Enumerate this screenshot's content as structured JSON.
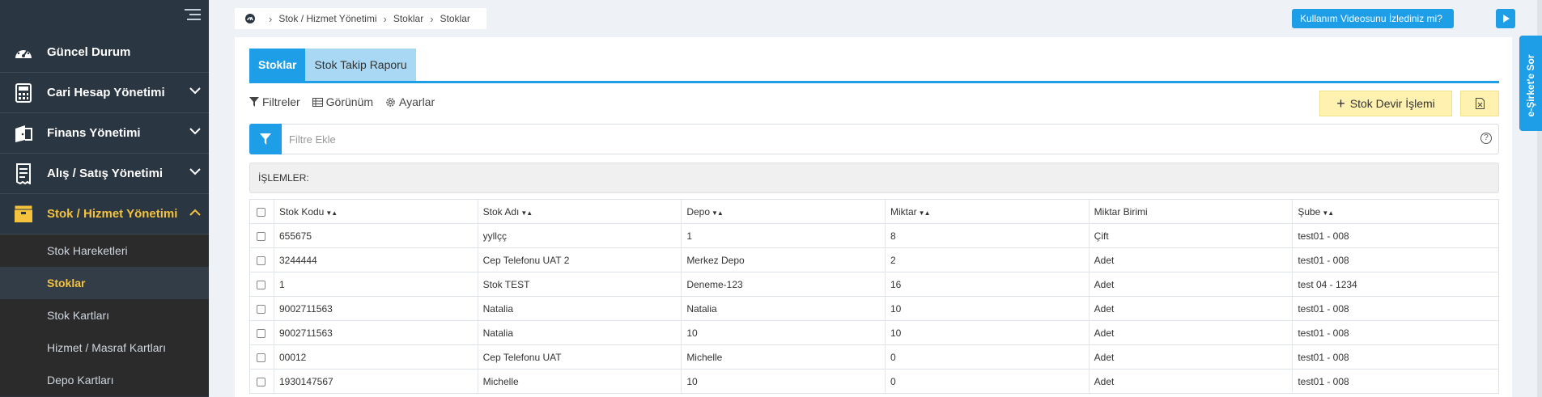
{
  "sidebar": {
    "menu": [
      {
        "label": "Güncel Durum",
        "icon": "dashboard-icon",
        "expandable": false
      },
      {
        "label": "Cari Hesap Yönetimi",
        "icon": "calculator-icon",
        "expandable": true
      },
      {
        "label": "Finans Yönetimi",
        "icon": "wallet-icon",
        "expandable": true
      },
      {
        "label": "Alış / Satış Yönetimi",
        "icon": "receipt-icon",
        "expandable": true
      },
      {
        "label": "Stok / Hizmet Yönetimi",
        "icon": "box-icon",
        "expandable": true,
        "active": true
      }
    ],
    "submenu": [
      {
        "label": "Stok Hareketleri"
      },
      {
        "label": "Stoklar",
        "active": true
      },
      {
        "label": "Stok Kartları"
      },
      {
        "label": "Hizmet / Masraf Kartları"
      },
      {
        "label": "Depo Kartları"
      }
    ]
  },
  "breadcrumb": {
    "items": [
      "Stok / Hizmet Yönetimi",
      "Stoklar",
      "Stoklar"
    ]
  },
  "video_prompt": "Kullanım Videosunu İzlediniz mi?",
  "side_tab": "e-Şirket'e Sor",
  "tabs": [
    {
      "label": "Stoklar",
      "active": true
    },
    {
      "label": "Stok Takip Raporu",
      "active": false
    }
  ],
  "toolbar": {
    "filters": "Filtreler",
    "view": "Görünüm",
    "settings": "Ayarlar",
    "stok_devir": "Stok Devir İşlemi"
  },
  "filter": {
    "placeholder": "Filtre Ekle"
  },
  "section_title": "İŞLEMLER:",
  "table": {
    "columns": [
      "Stok Kodu",
      "Stok Adı",
      "Depo",
      "Miktar",
      "Miktar Birimi",
      "Şube"
    ],
    "rows": [
      [
        "655675",
        "yyllçç",
        "1",
        "8",
        "Çift",
        "test01 - 008"
      ],
      [
        "3244444",
        "Cep Telefonu UAT 2",
        "Merkez Depo",
        "2",
        "Adet",
        "test01 - 008"
      ],
      [
        "1",
        "Stok TEST",
        "Deneme-123",
        "16",
        "Adet",
        "test 04 - 1234"
      ],
      [
        "9002711563",
        "Natalia",
        "Natalia",
        "10",
        "Adet",
        "test01 - 008"
      ],
      [
        "9002711563",
        "Natalia",
        "10",
        "10",
        "Adet",
        "test01 - 008"
      ],
      [
        "00012",
        "Cep Telefonu UAT",
        "Michelle",
        "0",
        "Adet",
        "test01 - 008"
      ],
      [
        "1930147567",
        "Michelle",
        "10",
        "0",
        "Adet",
        "test01 - 008"
      ]
    ]
  },
  "colors": {
    "sidebar_bg": "#2b3643",
    "accent": "#1e9ee6",
    "active_menu": "#f4c23c",
    "action_button": "#fff2b0"
  }
}
